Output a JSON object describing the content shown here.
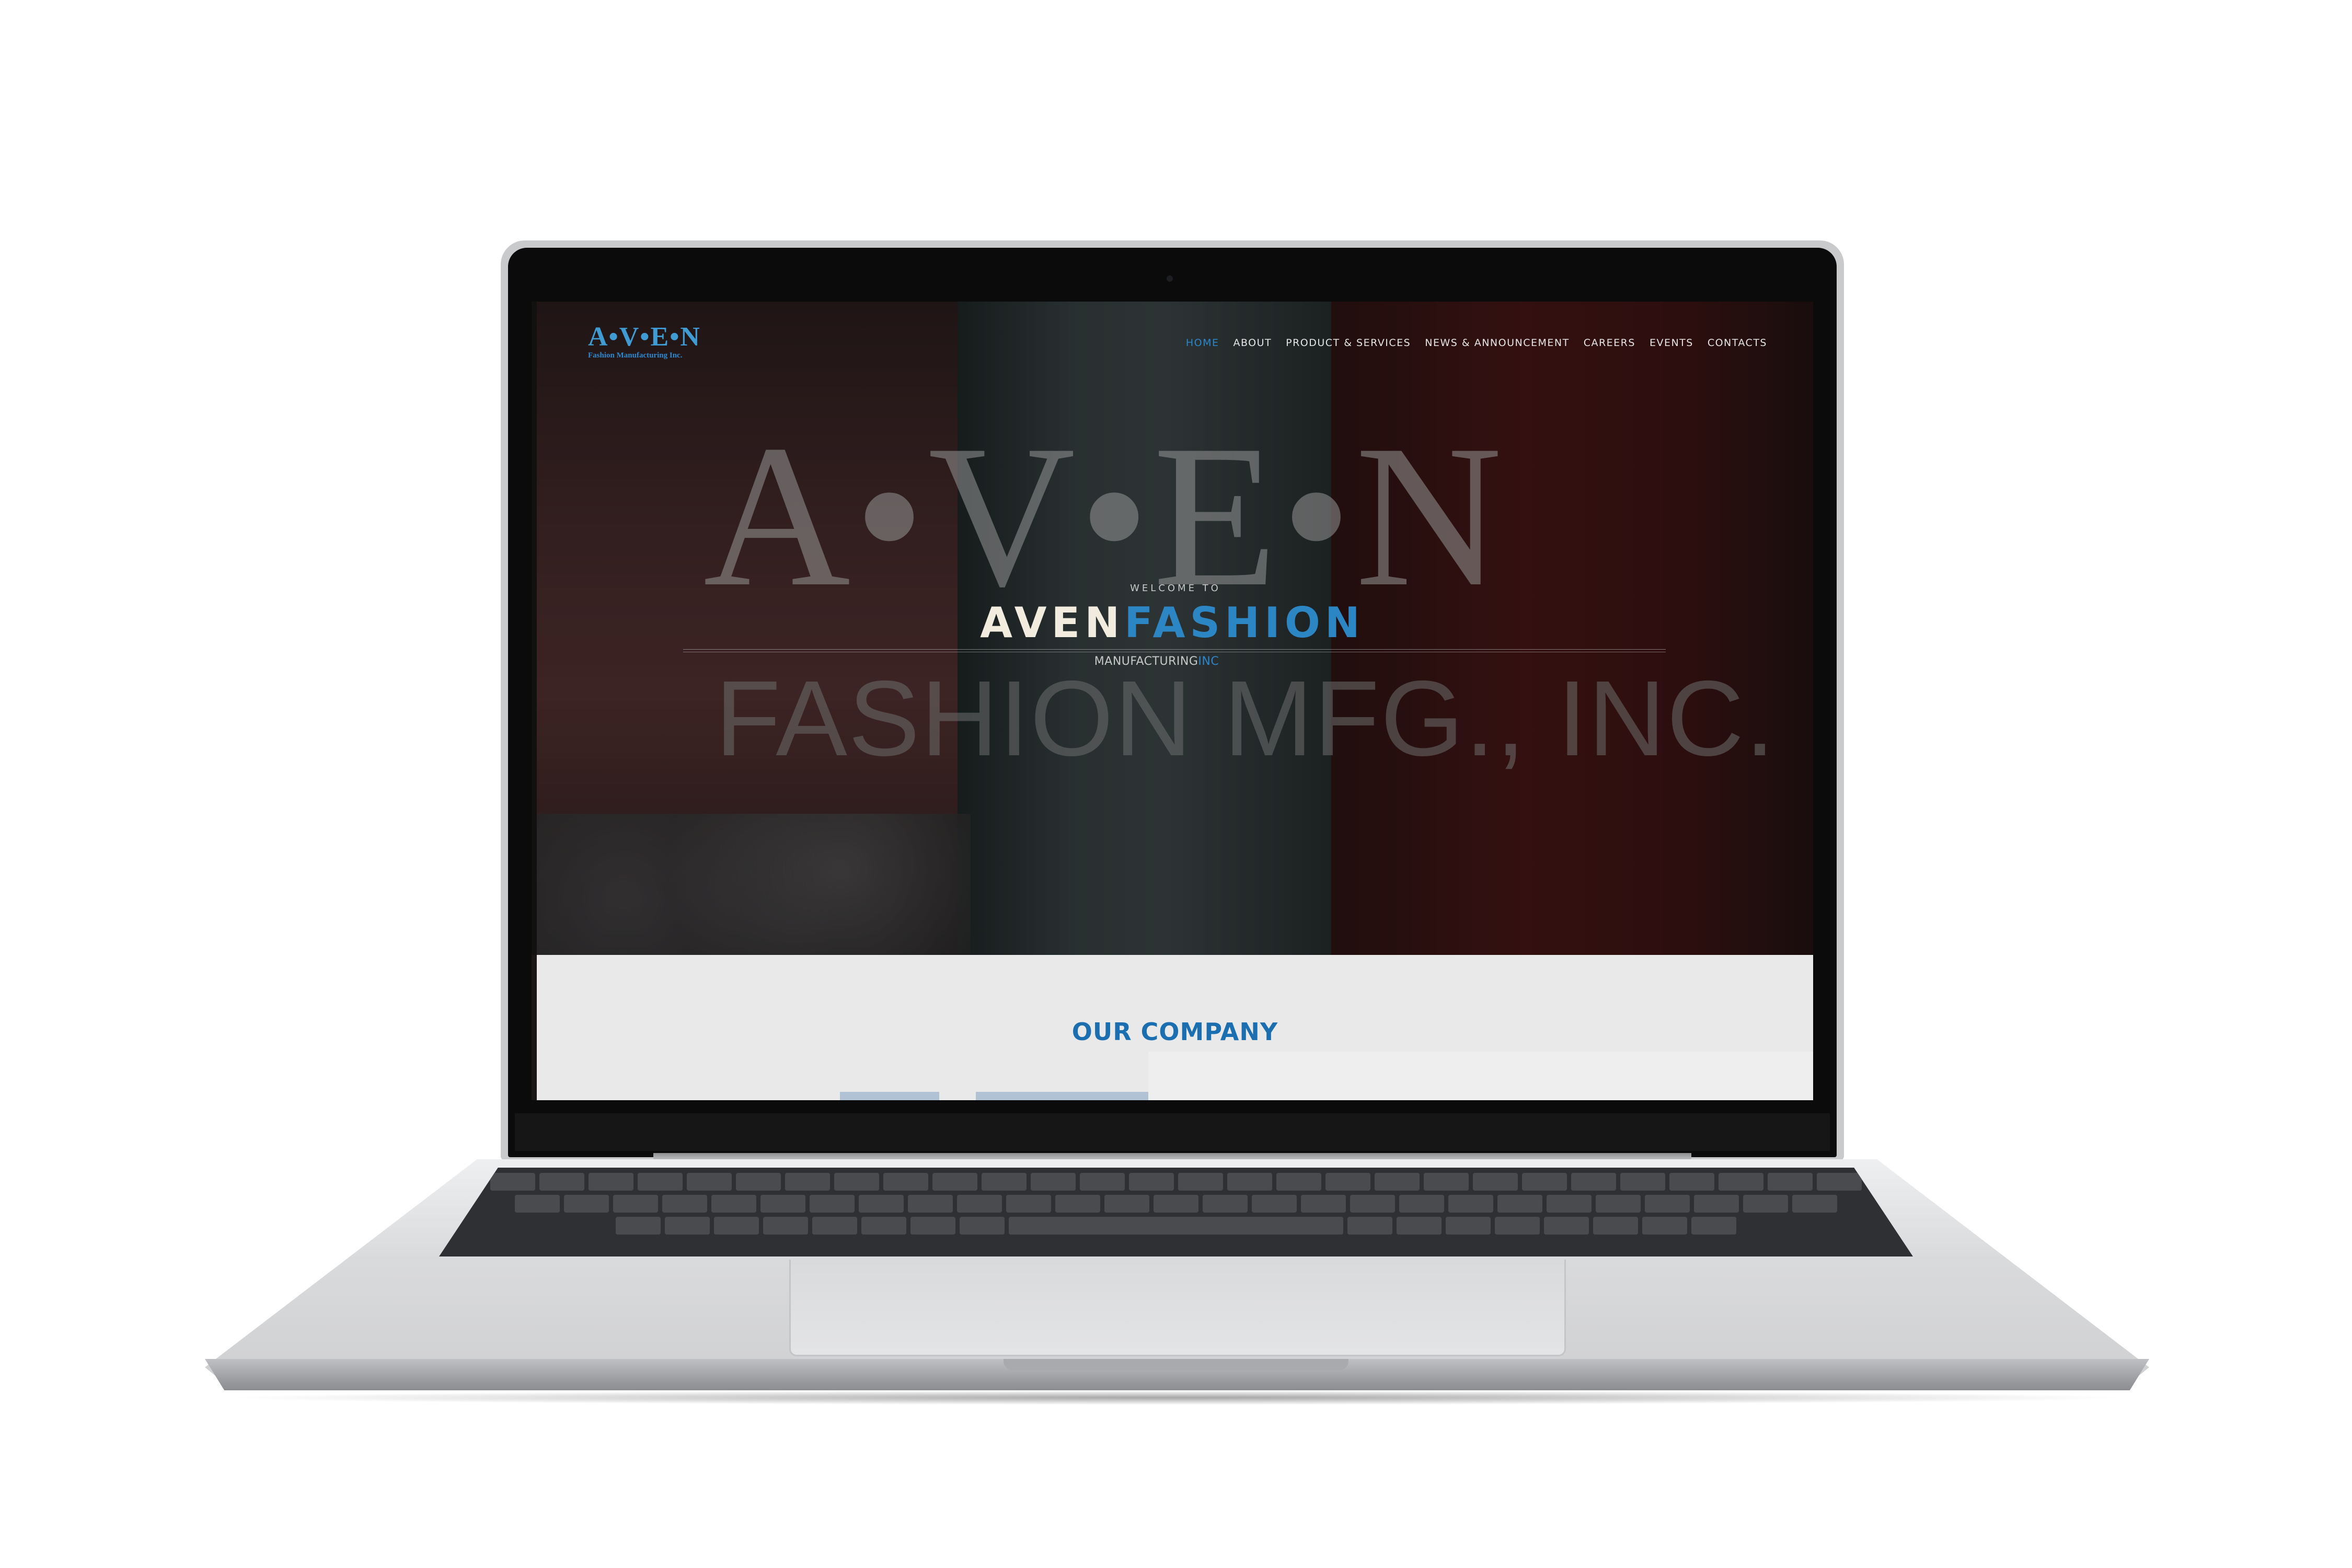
{
  "site": {
    "logo": {
      "mark": "A•V•E•N",
      "subtitle": "Fashion Manufacturing Inc."
    },
    "nav": [
      {
        "label": "HOME",
        "active": true
      },
      {
        "label": "ABOUT",
        "active": false
      },
      {
        "label": "PRODUCT & SERVICES",
        "active": false
      },
      {
        "label": "NEWS & ANNOUNCEMENT",
        "active": false
      },
      {
        "label": "CAREERS",
        "active": false
      },
      {
        "label": "EVENTS",
        "active": false
      },
      {
        "label": "CONTACTS",
        "active": false
      }
    ],
    "hero": {
      "watermark_top": "A•V•E•N",
      "watermark_bottom": "FASHION MFG., INC.",
      "welcome": "WELCOME TO",
      "headline_white": "AVEN",
      "headline_blue": "FASHION",
      "tagline_main": "MANUFACTURING",
      "tagline_suffix": "INC"
    },
    "company": {
      "title": "OUR COMPANY"
    }
  },
  "colors": {
    "accent_blue": "#2b86cc",
    "headline_cream": "#f2ecdf",
    "section_bg": "#e9e9ea"
  }
}
